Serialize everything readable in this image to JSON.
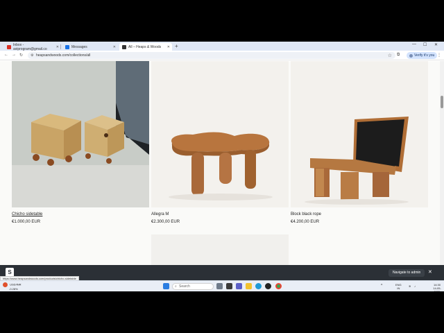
{
  "browser": {
    "tabs": [
      {
        "label": "Inbox - aviprogram@gmail.co",
        "favicon_color": "#d93025"
      },
      {
        "label": "Messages",
        "favicon_color": "#1a73e8"
      },
      {
        "label": "All – Heaps & Woods",
        "favicon_color": "#333333"
      }
    ],
    "url": "heapsandwoods.com/collections/all",
    "profile_label": "Verify it's you"
  },
  "products": [
    {
      "title": "Chicho sidetable",
      "price": "€1.000,00 EUR"
    },
    {
      "title": "Allegra M",
      "price": "€2.300,00 EUR"
    },
    {
      "title": "Block black rope",
      "price": "€4.200,00 EUR"
    }
  ],
  "admin_bar": {
    "navigate_label": "Navigate to admin",
    "close_symbol": "✕"
  },
  "status_url": "https://www.heapsandwoods.com/products/chicho-sidetable",
  "taskbar": {
    "weather_line1": "USD/INR",
    "weather_line2": "-0.28%",
    "search_placeholder": "Search",
    "language_line1": "ENG",
    "language_line2": "IN",
    "time": "14:30",
    "date": "14-05-2025"
  }
}
